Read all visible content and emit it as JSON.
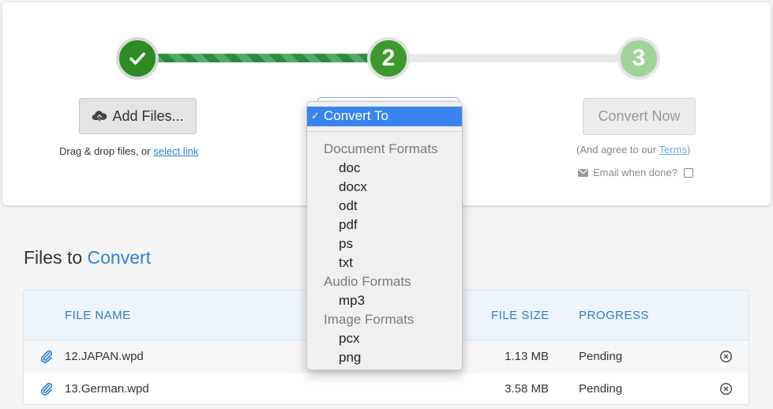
{
  "steps": [
    {
      "label": "✓",
      "state": "done"
    },
    {
      "label": "2",
      "state": "current"
    },
    {
      "label": "3",
      "state": "pending"
    }
  ],
  "upload": {
    "button_label": "Add Files...",
    "drag_text": "Drag & drop files, or",
    "select_link": "select link"
  },
  "convert": {
    "selected": "Convert To",
    "groups": [
      {
        "label": "Document Formats",
        "options": [
          "doc",
          "docx",
          "odt",
          "pdf",
          "ps",
          "txt"
        ]
      },
      {
        "label": "Audio Formats",
        "options": [
          "mp3"
        ]
      },
      {
        "label": "Image Formats",
        "options": [
          "pcx",
          "png"
        ]
      }
    ]
  },
  "convert_now": {
    "button_label": "Convert Now",
    "agree_prefix": "(And agree to our",
    "terms_link": "Terms",
    "agree_suffix": ")",
    "email_label": "Email when done?"
  },
  "files": {
    "title_prefix": "Files to",
    "title_accent": "Convert",
    "columns": {
      "name": "FILE NAME",
      "size": "FILE SIZE",
      "progress": "PROGRESS"
    },
    "rows": [
      {
        "name": "12.JAPAN.wpd",
        "size": "1.13 MB",
        "progress": "Pending"
      },
      {
        "name": "13.German.wpd",
        "size": "3.58 MB",
        "progress": "Pending"
      }
    ]
  },
  "colors": {
    "accent": "#2d86d3",
    "step_done": "#2e8b23",
    "step_pending": "#9fd39a",
    "dropdown_highlight": "#3a84f0"
  }
}
